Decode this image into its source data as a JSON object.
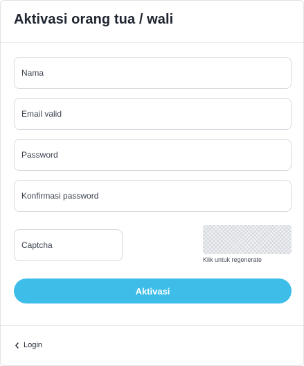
{
  "header": {
    "title": "Aktivasi orang tua / wali"
  },
  "form": {
    "name_placeholder": "Nama",
    "email_placeholder": "Email valid",
    "password_placeholder": "Password",
    "confirm_password_placeholder": "Konfirmasi password",
    "captcha_placeholder": "Captcha",
    "captcha_hint": "Klik untuk regenerate",
    "submit_label": "Aktivasi"
  },
  "footer": {
    "login_label": "Login",
    "login_icon": "chevron-left-icon"
  },
  "colors": {
    "accent": "#3dbde8",
    "text": "#1f2530",
    "border": "#d6dae0"
  }
}
